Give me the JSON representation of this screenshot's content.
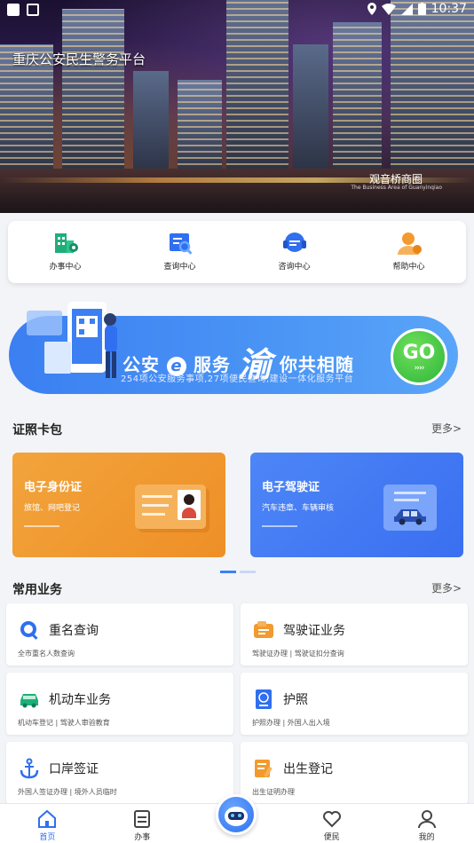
{
  "status_bar": {
    "time": "10:37"
  },
  "hero": {
    "title": "重庆公安民生警务平台",
    "caption": "观音桥商圈",
    "caption_sub": "The Business Area of Guanyinqiao"
  },
  "quick_menu": [
    {
      "label": "办事中心",
      "icon": "building-pin-icon"
    },
    {
      "label": "查询中心",
      "icon": "search-doc-icon"
    },
    {
      "label": "咨询中心",
      "icon": "headset-icon"
    },
    {
      "label": "帮助中心",
      "icon": "user-help-icon"
    }
  ],
  "banner": {
    "main_a": "公安",
    "main_e": "e",
    "main_b": "服务",
    "main_big": "渝",
    "main_c": "你共相随",
    "sub": "254项公安服务事项,27项便民查询,建设一体化服务平台",
    "go": "GO",
    "go_arrows": "››››"
  },
  "wallet": {
    "title": "证照卡包",
    "more": "更多>",
    "cards": [
      {
        "title": "电子身份证",
        "desc": "旅馆、网吧登记"
      },
      {
        "title": "电子驾驶证",
        "desc": "汽车违章、车辆审核"
      }
    ]
  },
  "services": {
    "title": "常用业务",
    "more": "更多>",
    "items": [
      {
        "name": "重名查询",
        "desc": "全市重名人数查询",
        "icon": "name-search-icon",
        "color": "#2f6ff0"
      },
      {
        "name": "驾驶证业务",
        "desc": "驾驶证办理 | 驾驶证扣分查询",
        "icon": "license-icon",
        "color": "#f29a2e"
      },
      {
        "name": "机动车业务",
        "desc": "机动车登记 | 驾驶人审验教育",
        "icon": "car-icon",
        "color": "#1fae7a"
      },
      {
        "name": "护照",
        "desc": "护照办理 | 外国人出入境",
        "icon": "passport-icon",
        "color": "#2f6ff0"
      },
      {
        "name": "口岸签证",
        "desc": "外国人签证办理 | 境外人员临时",
        "icon": "anchor-icon",
        "color": "#2f6ff0"
      },
      {
        "name": "出生登记",
        "desc": "出生证明办理",
        "icon": "birth-cert-icon",
        "color": "#f29a2e"
      }
    ]
  },
  "tabbar": [
    {
      "label": "首页",
      "icon": "home-icon",
      "active": true
    },
    {
      "label": "办事",
      "icon": "doc-icon",
      "active": false
    },
    {
      "label": "便民",
      "icon": "heart-icon",
      "active": false
    },
    {
      "label": "我的",
      "icon": "person-icon",
      "active": false
    }
  ],
  "colors": {
    "accent": "#2f6ff0",
    "orange": "#f29a2e",
    "green": "#1fae7a"
  }
}
